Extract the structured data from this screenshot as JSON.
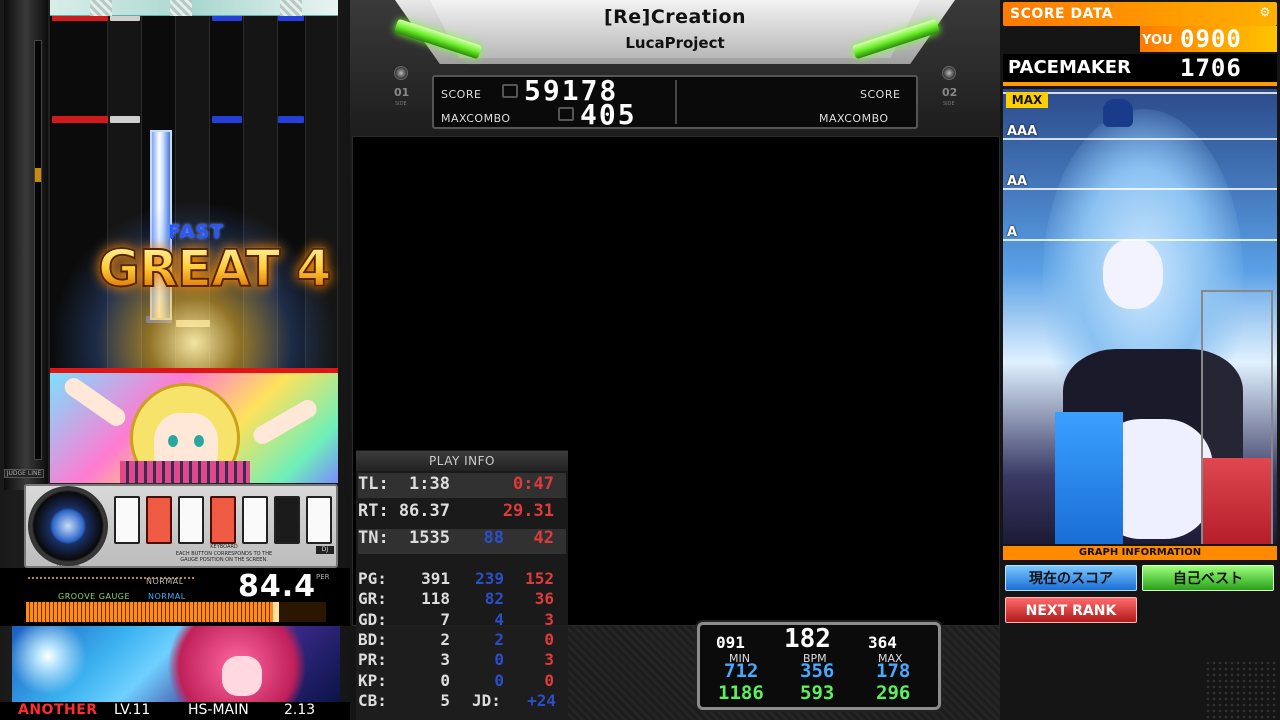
{
  "song": {
    "title": "[Re]Creation",
    "artist": "LucaProject"
  },
  "sides": {
    "left": "01",
    "right": "02",
    "side_word": "SIDE"
  },
  "scoreboard": {
    "score_label": "SCORE",
    "score_value": "59178",
    "maxcombo_label": "MAXCOMBO",
    "maxcombo_value": "405",
    "p2_score_label": "SCORE",
    "p2_maxcombo_label": "MAXCOMBO"
  },
  "judgement": {
    "timing": "FAST",
    "text": "GREAT",
    "combo": "4"
  },
  "judge_line_tag": "JUDGE LINE",
  "controller": {
    "keys_pressed": [
      false,
      true,
      false,
      true,
      false,
      false,
      false
    ],
    "keyboard_title": "KEYBOARD",
    "keyboard_hint": "EACH BUTTON CORRESPONDS TO THE GAUGE POSITION ON THE SCREEN.",
    "turntable_label": "TURNTABLE",
    "dj_tag": "DJ"
  },
  "gauge": {
    "top_label": "NORMAL",
    "title": "GROOVE GAUGE",
    "mode": "NORMAL",
    "value": "84.4",
    "unit": "PER",
    "level_fraction": 0.844
  },
  "song_info": {
    "difficulty": "ANOTHER",
    "level": "LV.11",
    "hs_label": "HS-MAIN",
    "hs_value": "2.13"
  },
  "play_info": {
    "title": "PLAY INFO",
    "rows": [
      {
        "key": "TL:",
        "value": "1:38",
        "red": "0:47",
        "blue": ""
      },
      {
        "key": "RT:",
        "value": "86.37",
        "red": "29.31",
        "blue": ""
      },
      {
        "key": "TN:",
        "value": "1535",
        "red": "42",
        "blue": "88"
      },
      {
        "key": "PG:",
        "value": "391",
        "red": "152",
        "blue": "239"
      },
      {
        "key": "GR:",
        "value": "118",
        "red": "36",
        "blue": "82"
      },
      {
        "key": "GD:",
        "value": "7",
        "red": "3",
        "blue": "4"
      },
      {
        "key": "BD:",
        "value": "2",
        "red": "0",
        "blue": "2"
      },
      {
        "key": "PR:",
        "value": "3",
        "red": "3",
        "blue": "0"
      },
      {
        "key": "KP:",
        "value": "0",
        "red": "0",
        "blue": "0"
      },
      {
        "key": "CB:",
        "value": "5",
        "red": "",
        "blue": ""
      }
    ],
    "jd_label": "JD:",
    "jd_value": "+24"
  },
  "bpm": {
    "min_small": "091",
    "current": "182",
    "max_small": "364",
    "labels": {
      "min": "MIN",
      "bpm": "BPM",
      "max": "MAX"
    },
    "row_blue": {
      "min": "712",
      "bpm": "356",
      "max": "178"
    },
    "row_green": {
      "min": "1186",
      "bpm": "593",
      "max": "296"
    }
  },
  "score_data": {
    "header": "SCORE DATA",
    "you_label": "YOU",
    "you_value": "0900",
    "pacemaker_label": "PACEMAKER",
    "pacemaker_value": "1706",
    "grades": [
      "MAX",
      "AAA",
      "AA",
      "A"
    ],
    "graph_info_label": "GRAPH INFORMATION",
    "you_fraction": 0.29,
    "pacemaker_fraction": 0.19
  },
  "right_buttons": {
    "current_score": "現在のスコア",
    "personal_best": "自己ベスト",
    "next_rank": "NEXT RANK"
  },
  "icons": {
    "settings": "gear-icon"
  }
}
